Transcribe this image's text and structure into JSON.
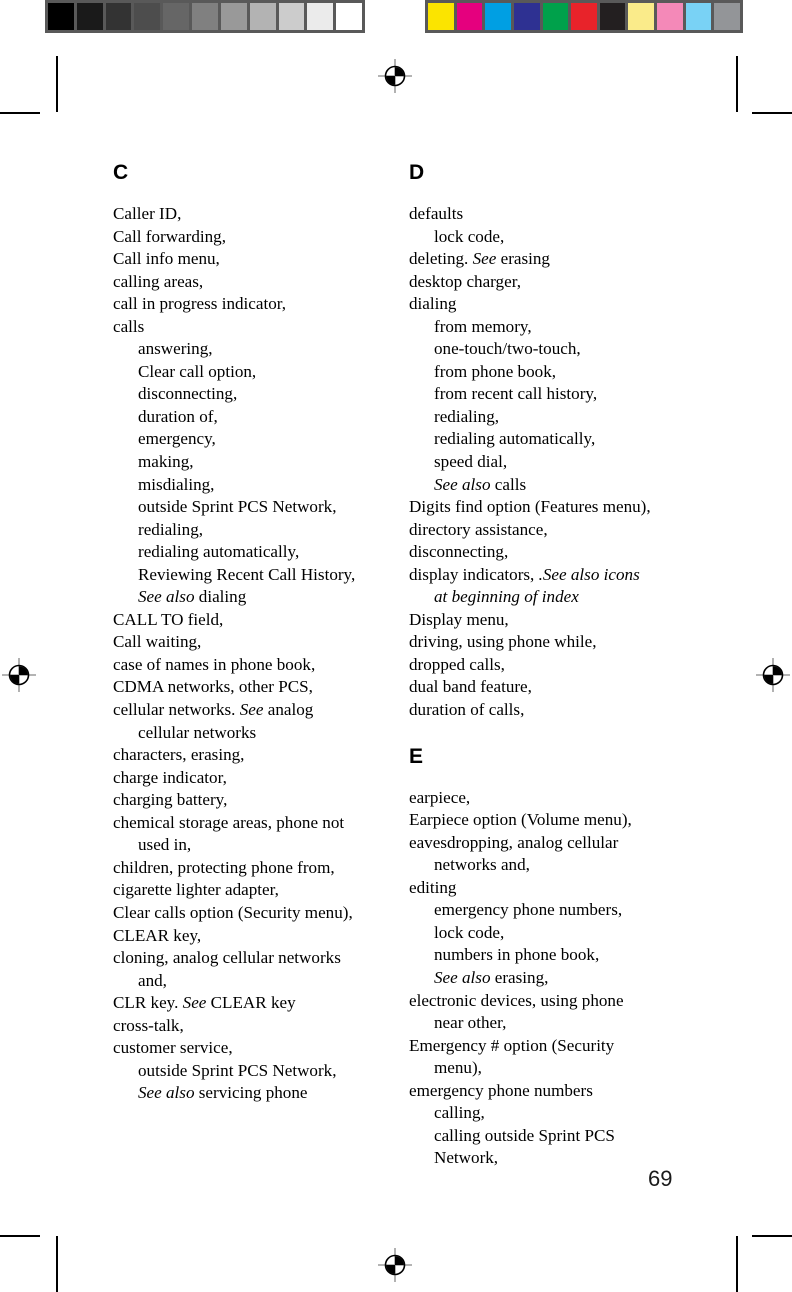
{
  "document": {
    "page_number": "69",
    "type": "index-page"
  },
  "calibration": {
    "grayscale_label": "grayscale-calibration-strip",
    "color_label": "color-calibration-strip",
    "grayscale_patches": [
      "#000000",
      "#1a1a1a",
      "#333333",
      "#4d4d4d",
      "#666666",
      "#808080",
      "#999999",
      "#b3b3b3",
      "#cccccc",
      "#ebebeb",
      "#ffffff"
    ],
    "color_patches": [
      "#fbe400",
      "#e5007e",
      "#009fe3",
      "#2e3192",
      "#00a14b",
      "#e8232a",
      "#231f20",
      "#faeb8a",
      "#f489b8",
      "#79d2f5",
      "#939598"
    ]
  },
  "columns": [
    {
      "letter": "C",
      "entries": [
        {
          "level": 0,
          "parts": [
            {
              "text": "Caller ID,",
              "style": "normal"
            }
          ]
        },
        {
          "level": 0,
          "parts": [
            {
              "text": "Call forwarding,",
              "style": "normal"
            }
          ]
        },
        {
          "level": 0,
          "parts": [
            {
              "text": "Call info menu,",
              "style": "normal"
            }
          ]
        },
        {
          "level": 0,
          "parts": [
            {
              "text": "calling areas,",
              "style": "normal"
            }
          ]
        },
        {
          "level": 0,
          "parts": [
            {
              "text": "call in progress indicator,",
              "style": "normal"
            }
          ]
        },
        {
          "level": 0,
          "parts": [
            {
              "text": "calls",
              "style": "normal"
            }
          ]
        },
        {
          "level": 1,
          "parts": [
            {
              "text": "answering,",
              "style": "normal"
            }
          ]
        },
        {
          "level": 1,
          "parts": [
            {
              "text": "Clear call option,",
              "style": "normal"
            }
          ]
        },
        {
          "level": 1,
          "parts": [
            {
              "text": "disconnecting,",
              "style": "normal"
            }
          ]
        },
        {
          "level": 1,
          "parts": [
            {
              "text": "duration of,",
              "style": "normal"
            }
          ]
        },
        {
          "level": 1,
          "parts": [
            {
              "text": "emergency,",
              "style": "normal"
            }
          ]
        },
        {
          "level": 1,
          "parts": [
            {
              "text": "making,",
              "style": "normal"
            }
          ]
        },
        {
          "level": 1,
          "parts": [
            {
              "text": "misdialing,",
              "style": "normal"
            }
          ]
        },
        {
          "level": 1,
          "parts": [
            {
              "text": "outside Sprint PCS Network,",
              "style": "normal"
            }
          ]
        },
        {
          "level": 1,
          "parts": [
            {
              "text": "redialing,",
              "style": "normal"
            }
          ]
        },
        {
          "level": 1,
          "parts": [
            {
              "text": "redialing automatically,",
              "style": "normal"
            }
          ]
        },
        {
          "level": 1,
          "parts": [
            {
              "text": "Reviewing Recent Call History,",
              "style": "normal"
            }
          ]
        },
        {
          "level": 1,
          "parts": [
            {
              "text": "See also",
              "style": "italic"
            },
            {
              "text": " dialing",
              "style": "normal"
            }
          ]
        },
        {
          "level": 0,
          "parts": [
            {
              "text": "CALL TO field,",
              "style": "normal"
            }
          ]
        },
        {
          "level": 0,
          "parts": [
            {
              "text": "Call waiting,",
              "style": "normal"
            }
          ]
        },
        {
          "level": 0,
          "parts": [
            {
              "text": "case of names in phone book,",
              "style": "normal"
            }
          ]
        },
        {
          "level": 0,
          "parts": [
            {
              "text": "CDMA networks, other PCS,",
              "style": "normal"
            }
          ]
        },
        {
          "level": 0,
          "parts": [
            {
              "text": "cellular networks. ",
              "style": "normal"
            },
            {
              "text": "See",
              "style": "italic"
            },
            {
              "text": " analog",
              "style": "normal"
            }
          ]
        },
        {
          "level": "cont",
          "parts": [
            {
              "text": "cellular networks",
              "style": "normal"
            }
          ]
        },
        {
          "level": 0,
          "parts": [
            {
              "text": "characters, erasing,",
              "style": "normal"
            }
          ]
        },
        {
          "level": 0,
          "parts": [
            {
              "text": "charge indicator,",
              "style": "normal"
            }
          ]
        },
        {
          "level": 0,
          "parts": [
            {
              "text": "charging battery,",
              "style": "normal"
            }
          ]
        },
        {
          "level": 0,
          "parts": [
            {
              "text": "chemical storage areas, phone not",
              "style": "normal"
            }
          ]
        },
        {
          "level": "cont",
          "parts": [
            {
              "text": "used in,",
              "style": "normal"
            }
          ]
        },
        {
          "level": 0,
          "parts": [
            {
              "text": "children, protecting phone from,",
              "style": "normal"
            }
          ]
        },
        {
          "level": 0,
          "parts": [
            {
              "text": "cigarette lighter adapter,",
              "style": "normal"
            }
          ]
        },
        {
          "level": 0,
          "parts": [
            {
              "text": "Clear calls option (Security menu),",
              "style": "normal"
            }
          ]
        },
        {
          "level": 0,
          "parts": [
            {
              "text": "CLEAR key,",
              "style": "normal"
            }
          ]
        },
        {
          "level": 0,
          "parts": [
            {
              "text": "cloning, analog cellular networks",
              "style": "normal"
            }
          ]
        },
        {
          "level": "cont",
          "parts": [
            {
              "text": "and,",
              "style": "normal"
            }
          ]
        },
        {
          "level": 0,
          "parts": [
            {
              "text": "CLR key. ",
              "style": "normal"
            },
            {
              "text": "See",
              "style": "italic"
            },
            {
              "text": " CLEAR key",
              "style": "normal"
            }
          ]
        },
        {
          "level": 0,
          "parts": [
            {
              "text": "cross-talk,",
              "style": "normal"
            }
          ]
        },
        {
          "level": 0,
          "parts": [
            {
              "text": "customer service,",
              "style": "normal"
            }
          ]
        },
        {
          "level": 1,
          "parts": [
            {
              "text": "outside Sprint PCS Network,",
              "style": "normal"
            }
          ]
        },
        {
          "level": 1,
          "parts": [
            {
              "text": "See also",
              "style": "italic"
            },
            {
              "text": " servicing phone",
              "style": "normal"
            }
          ]
        }
      ]
    }
  ],
  "column_right_sections": [
    {
      "letter": "D",
      "spaced_above": false,
      "entries": [
        {
          "level": 0,
          "parts": [
            {
              "text": "defaults",
              "style": "normal"
            }
          ]
        },
        {
          "level": 1,
          "parts": [
            {
              "text": "lock code,",
              "style": "normal"
            }
          ]
        },
        {
          "level": 0,
          "parts": [
            {
              "text": "deleting. ",
              "style": "normal"
            },
            {
              "text": "See",
              "style": "italic"
            },
            {
              "text": " erasing",
              "style": "normal"
            }
          ]
        },
        {
          "level": 0,
          "parts": [
            {
              "text": "desktop charger,",
              "style": "normal"
            }
          ]
        },
        {
          "level": 0,
          "parts": [
            {
              "text": "dialing",
              "style": "normal"
            }
          ]
        },
        {
          "level": 1,
          "parts": [
            {
              "text": "from memory,",
              "style": "normal"
            }
          ]
        },
        {
          "level": 1,
          "parts": [
            {
              "text": "one-touch/two-touch,",
              "style": "normal"
            }
          ]
        },
        {
          "level": 1,
          "parts": [
            {
              "text": "from phone book,",
              "style": "normal"
            }
          ]
        },
        {
          "level": 1,
          "parts": [
            {
              "text": "from recent call history,",
              "style": "normal"
            }
          ]
        },
        {
          "level": 1,
          "parts": [
            {
              "text": "redialing,",
              "style": "normal"
            }
          ]
        },
        {
          "level": 1,
          "parts": [
            {
              "text": "redialing automatically,",
              "style": "normal"
            }
          ]
        },
        {
          "level": 1,
          "parts": [
            {
              "text": "speed dial,",
              "style": "normal"
            }
          ]
        },
        {
          "level": 1,
          "parts": [
            {
              "text": "See also",
              "style": "italic"
            },
            {
              "text": " calls",
              "style": "normal"
            }
          ]
        },
        {
          "level": 0,
          "parts": [
            {
              "text": "Digits find option (Features menu),",
              "style": "normal"
            }
          ]
        },
        {
          "level": 0,
          "parts": [
            {
              "text": "directory assistance,",
              "style": "normal"
            }
          ]
        },
        {
          "level": 0,
          "parts": [
            {
              "text": "disconnecting,",
              "style": "normal"
            }
          ]
        },
        {
          "level": 0,
          "parts": [
            {
              "text": "display indicators, ",
              "style": "normal"
            },
            {
              "text": ".See also icons",
              "style": "italic"
            }
          ]
        },
        {
          "level": "cont",
          "parts": [
            {
              "text": "at beginning of index",
              "style": "italic"
            }
          ]
        },
        {
          "level": 0,
          "parts": [
            {
              "text": "Display menu,",
              "style": "normal"
            }
          ]
        },
        {
          "level": 0,
          "parts": [
            {
              "text": "driving, using phone while,",
              "style": "normal"
            }
          ]
        },
        {
          "level": 0,
          "parts": [
            {
              "text": "dropped calls,",
              "style": "normal"
            }
          ]
        },
        {
          "level": 0,
          "parts": [
            {
              "text": "dual band feature,",
              "style": "normal"
            }
          ]
        },
        {
          "level": 0,
          "parts": [
            {
              "text": "duration of calls,",
              "style": "normal"
            }
          ]
        }
      ]
    },
    {
      "letter": "E",
      "spaced_above": true,
      "entries": [
        {
          "level": 0,
          "parts": [
            {
              "text": "earpiece,",
              "style": "normal"
            }
          ]
        },
        {
          "level": 0,
          "parts": [
            {
              "text": "Earpiece option (Volume menu),",
              "style": "normal"
            }
          ]
        },
        {
          "level": 0,
          "parts": [
            {
              "text": "eavesdropping, analog cellular",
              "style": "normal"
            }
          ]
        },
        {
          "level": "cont",
          "parts": [
            {
              "text": "networks and,",
              "style": "normal"
            }
          ]
        },
        {
          "level": 0,
          "parts": [
            {
              "text": "editing",
              "style": "normal"
            }
          ]
        },
        {
          "level": 1,
          "parts": [
            {
              "text": "emergency phone numbers,",
              "style": "normal"
            }
          ]
        },
        {
          "level": 1,
          "parts": [
            {
              "text": "lock code,",
              "style": "normal"
            }
          ]
        },
        {
          "level": 1,
          "parts": [
            {
              "text": "numbers in phone book,",
              "style": "normal"
            }
          ]
        },
        {
          "level": 1,
          "parts": [
            {
              "text": "See also",
              "style": "italic"
            },
            {
              "text": " erasing,",
              "style": "normal"
            }
          ]
        },
        {
          "level": 0,
          "parts": [
            {
              "text": "electronic devices, using phone",
              "style": "normal"
            }
          ]
        },
        {
          "level": "cont",
          "parts": [
            {
              "text": "near other,",
              "style": "normal"
            }
          ]
        },
        {
          "level": 0,
          "parts": [
            {
              "text": "Emergency # option (Security",
              "style": "normal"
            }
          ]
        },
        {
          "level": "cont",
          "parts": [
            {
              "text": "menu),",
              "style": "normal"
            }
          ]
        },
        {
          "level": 0,
          "parts": [
            {
              "text": "emergency phone numbers",
              "style": "normal"
            }
          ]
        },
        {
          "level": 1,
          "parts": [
            {
              "text": "calling,",
              "style": "normal"
            }
          ]
        },
        {
          "level": 1,
          "parts": [
            {
              "text": "calling outside Sprint PCS",
              "style": "normal"
            }
          ]
        },
        {
          "level": 1,
          "parts": [
            {
              "text": "Network,",
              "style": "normal"
            }
          ]
        }
      ]
    }
  ]
}
